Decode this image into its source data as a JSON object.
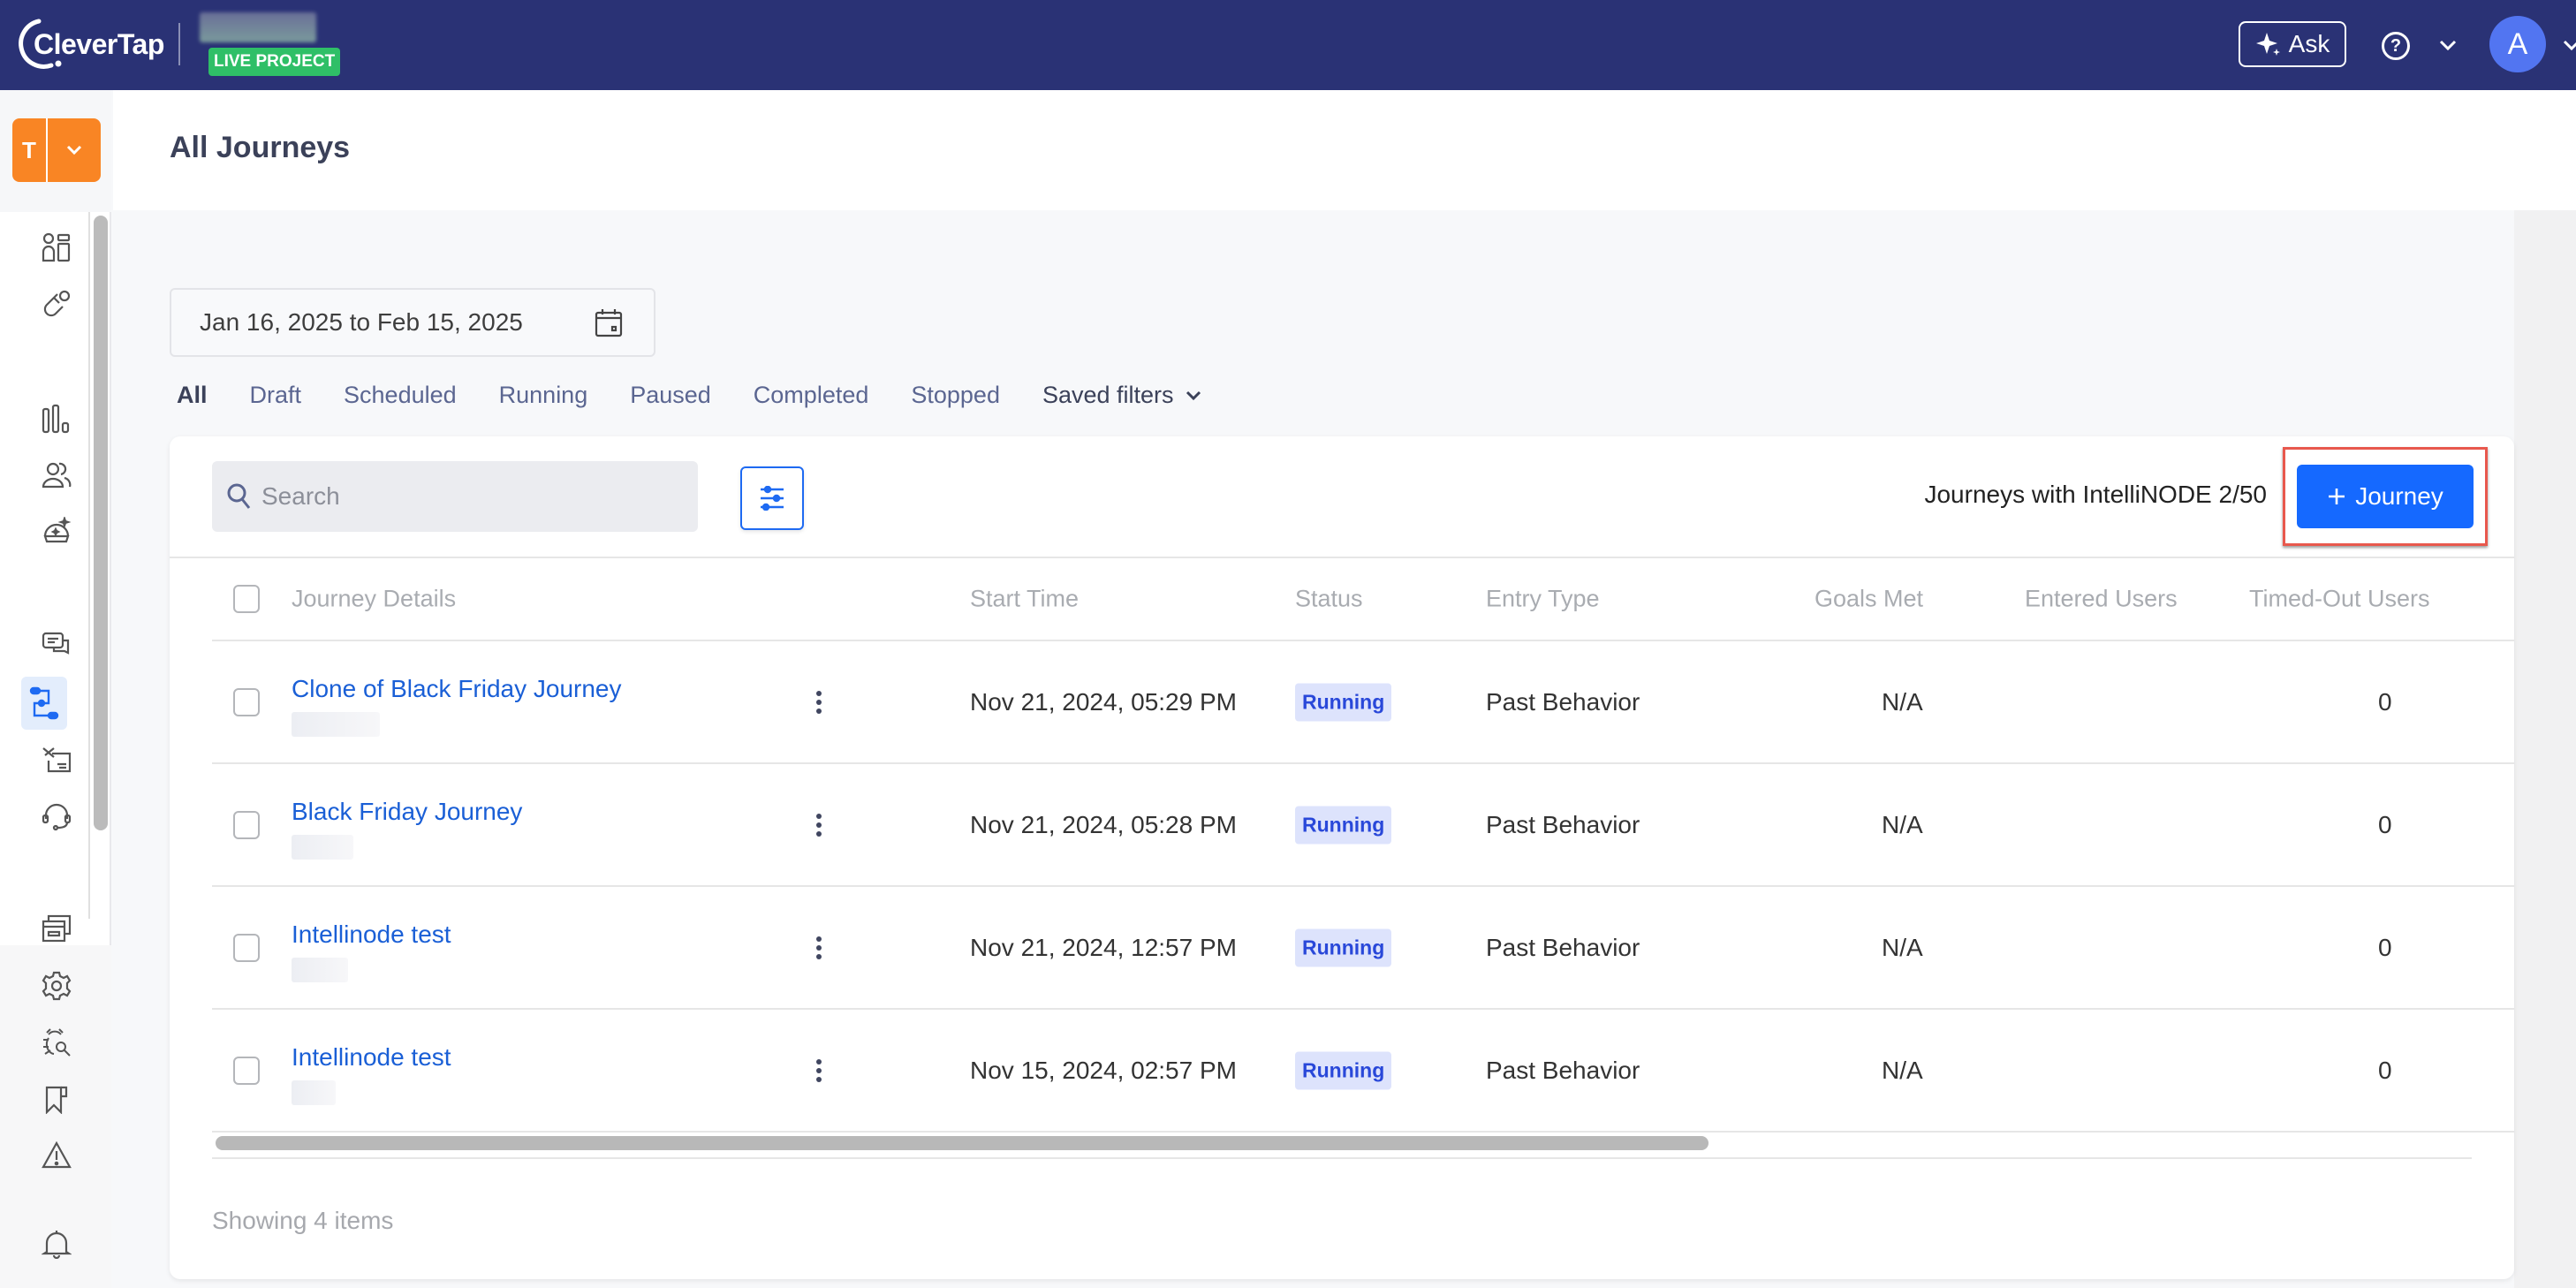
{
  "header": {
    "logo_text": "CleverTap",
    "project_badge": "LIVE PROJECT",
    "ask_label": "Ask",
    "avatar_initial": "A"
  },
  "sidebar": {
    "workspace_letter": "T",
    "items": [
      {
        "icon": "dashboard-icon"
      },
      {
        "icon": "magnet-icon"
      },
      {
        "icon": "analytics-bar-icon"
      },
      {
        "icon": "users-icon"
      },
      {
        "icon": "ai-bowl-icon"
      },
      {
        "icon": "messages-icon"
      },
      {
        "icon": "journeys-flow-icon",
        "active": true
      },
      {
        "icon": "campaign-icon"
      },
      {
        "icon": "support-headset-icon"
      },
      {
        "icon": "windows-icon"
      },
      {
        "icon": "settings-gear-icon"
      },
      {
        "icon": "bug-search-icon"
      },
      {
        "icon": "bookmark-icon"
      },
      {
        "icon": "warning-icon"
      },
      {
        "icon": "bell-icon"
      }
    ]
  },
  "page": {
    "title": "All Journeys",
    "date_range": "Jan 16, 2025 to Feb 15, 2025"
  },
  "tabs": [
    {
      "label": "All",
      "active": true
    },
    {
      "label": "Draft"
    },
    {
      "label": "Scheduled"
    },
    {
      "label": "Running"
    },
    {
      "label": "Paused"
    },
    {
      "label": "Completed"
    },
    {
      "label": "Stopped"
    }
  ],
  "saved_filters_label": "Saved filters",
  "toolbar": {
    "search_placeholder": "Search",
    "intellinode_count": "Journeys with IntelliNODE 2/50",
    "add_journey_label": "Journey"
  },
  "table": {
    "columns": [
      "Journey Details",
      "Start Time",
      "Status",
      "Entry Type",
      "Goals Met",
      "Entered Users",
      "Timed-Out Users"
    ],
    "rows": [
      {
        "name": "Clone of Black Friday Journey",
        "start_time": "Nov 21, 2024, 05:29 PM",
        "status": "Running",
        "entry_type": "Past Behavior",
        "goals_met": "N/A",
        "entered_users": "",
        "timed_out_users": "0"
      },
      {
        "name": "Black Friday Journey",
        "start_time": "Nov 21, 2024, 05:28 PM",
        "status": "Running",
        "entry_type": "Past Behavior",
        "goals_met": "N/A",
        "entered_users": "",
        "timed_out_users": "0"
      },
      {
        "name": "Intellinode test",
        "start_time": "Nov 21, 2024, 12:57 PM",
        "status": "Running",
        "entry_type": "Past Behavior",
        "goals_met": "N/A",
        "entered_users": "",
        "timed_out_users": "0"
      },
      {
        "name": "Intellinode test",
        "start_time": "Nov 15, 2024, 02:57 PM",
        "status": "Running",
        "entry_type": "Past Behavior",
        "goals_met": "N/A",
        "entered_users": "",
        "timed_out_users": "0"
      }
    ],
    "footer": "Showing 4 items"
  },
  "colors": {
    "header_bg": "#2a3275",
    "accent": "#1569ff",
    "live_badge": "#2fbf67",
    "workspace": "#f98524",
    "status_running_bg": "#dde3fc",
    "status_running_text": "#2948d9",
    "highlight": "#e8584d"
  }
}
